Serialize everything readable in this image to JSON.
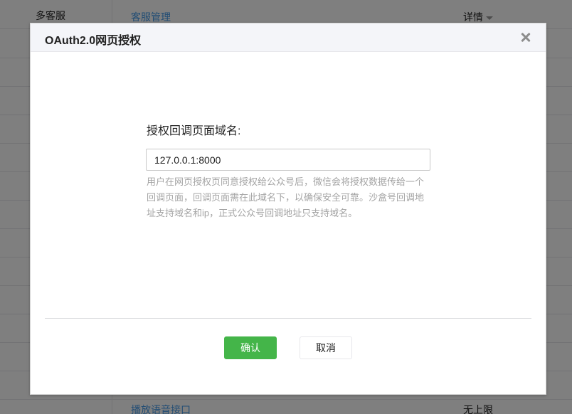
{
  "background": {
    "top_row": {
      "category": "多客服",
      "name": "客服管理",
      "limit": "详情"
    },
    "bottom_row": {
      "name": "播放语音接口",
      "limit": "无上限"
    }
  },
  "dialog": {
    "title": "OAuth2.0网页授权",
    "field_label": "授权回调页面域名:",
    "field_value": "127.0.0.1:8000",
    "tip": "用户在网页授权页同意授权给公众号后，微信会将授权数据传给一个回调页面，回调页面需在此域名下，以确保安全可靠。沙盒号回调地址支持域名和ip，正式公众号回调地址只支持域名。",
    "confirm_label": "确认",
    "cancel_label": "取消"
  },
  "colors": {
    "primary": "#44b549",
    "link": "#459ae9"
  }
}
